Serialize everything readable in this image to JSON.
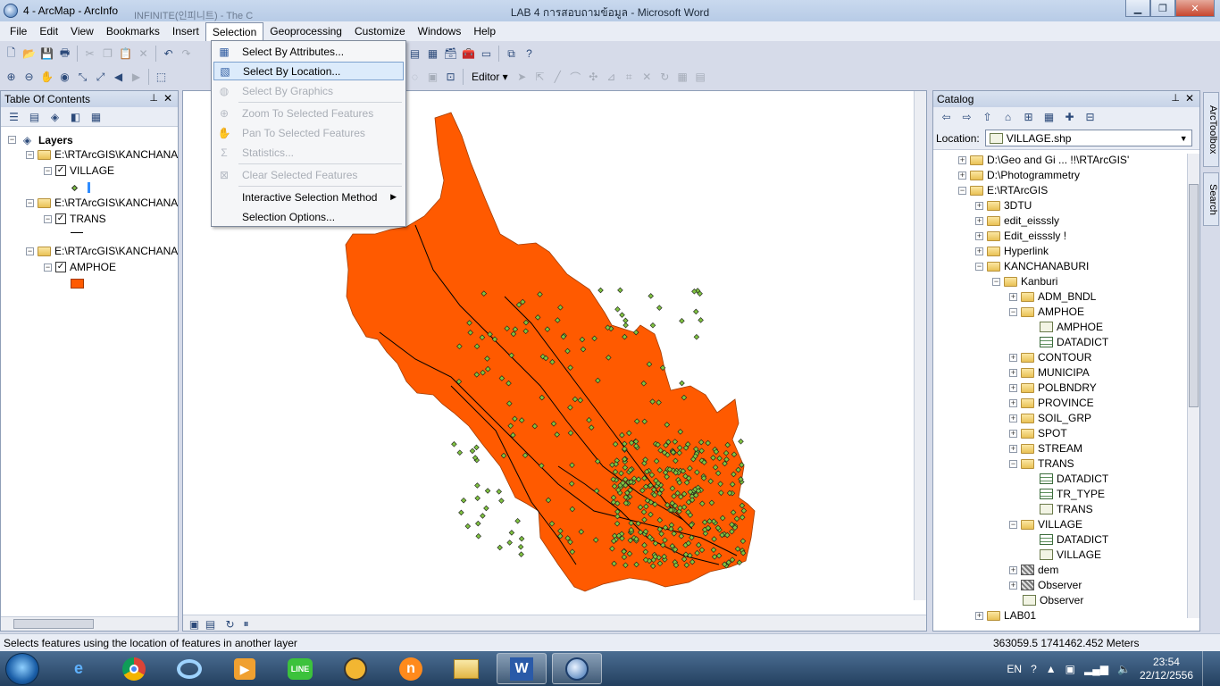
{
  "titlebar": {
    "title": "4 - ArcMap - ArcInfo",
    "background_title": "INFINITE(인피니트) - The C",
    "word_title": "LAB 4 การสอบถามข้อมูล - Microsoft Word",
    "minimize": "▁",
    "restore": "❐",
    "close": "✕"
  },
  "menubar": {
    "items": [
      "File",
      "Edit",
      "View",
      "Bookmarks",
      "Insert",
      "Selection",
      "Geoprocessing",
      "Customize",
      "Windows",
      "Help"
    ]
  },
  "toolbar": {
    "editor_label": "Editor ▾"
  },
  "selection_menu": {
    "items": [
      {
        "label": "Select By Attributes...",
        "icon": "table-select-icon",
        "enabled": true
      },
      {
        "label": "Select By Location...",
        "icon": "location-select-icon",
        "enabled": true,
        "highlighted": true
      },
      {
        "label": "Select By Graphics",
        "icon": "graphics-select-icon",
        "enabled": false
      },
      {
        "label": "Zoom To Selected Features",
        "icon": "zoom-selected-icon",
        "enabled": false
      },
      {
        "label": "Pan To Selected Features",
        "icon": "pan-selected-icon",
        "enabled": false
      },
      {
        "label": "Statistics...",
        "icon": "sigma-icon",
        "enabled": false
      },
      {
        "label": "Clear Selected Features",
        "icon": "clear-selection-icon",
        "enabled": false
      },
      {
        "label": "Interactive Selection Method",
        "icon": "",
        "enabled": true,
        "submenu": true
      },
      {
        "label": "Selection Options...",
        "icon": "",
        "enabled": true
      }
    ]
  },
  "toc": {
    "title": "Table Of Contents",
    "root": "Layers",
    "groups": [
      {
        "path": "E:\\RTArcGIS\\KANCHANA",
        "layer": "VILLAGE",
        "symbol": "point"
      },
      {
        "path": "E:\\RTArcGIS\\KANCHANA",
        "layer": "TRANS",
        "symbol": "line"
      },
      {
        "path": "E:\\RTArcGIS\\KANCHANA",
        "layer": "AMPHOE",
        "symbol": "polygon"
      }
    ]
  },
  "catalog": {
    "title": "Catalog",
    "location_label": "Location:",
    "location_value": "VILLAGE.shp",
    "tree": [
      {
        "label": "D:\\Geo and Gi ... !!\\RTArcGIS'",
        "indent": 0,
        "exp": "+",
        "type": "folder"
      },
      {
        "label": "D:\\Photogrammetry",
        "indent": 0,
        "exp": "+",
        "type": "folder"
      },
      {
        "label": "E:\\RTArcGIS",
        "indent": 0,
        "exp": "-",
        "type": "folder"
      },
      {
        "label": "3DTU",
        "indent": 1,
        "exp": "+",
        "type": "folder"
      },
      {
        "label": "edit_eisssly",
        "indent": 1,
        "exp": "+",
        "type": "folder"
      },
      {
        "label": "Edit_eisssly !",
        "indent": 1,
        "exp": "+",
        "type": "folder"
      },
      {
        "label": "Hyperlink",
        "indent": 1,
        "exp": "+",
        "type": "folder"
      },
      {
        "label": "KANCHANABURI",
        "indent": 1,
        "exp": "-",
        "type": "folder"
      },
      {
        "label": "Kanburi",
        "indent": 2,
        "exp": "-",
        "type": "folder"
      },
      {
        "label": "ADM_BNDL",
        "indent": 3,
        "exp": "+",
        "type": "folder"
      },
      {
        "label": "AMPHOE",
        "indent": 3,
        "exp": "-",
        "type": "folder"
      },
      {
        "label": "AMPHOE",
        "indent": 4,
        "exp": "",
        "type": "shp"
      },
      {
        "label": "DATADICT",
        "indent": 4,
        "exp": "",
        "type": "table"
      },
      {
        "label": "CONTOUR",
        "indent": 3,
        "exp": "+",
        "type": "folder"
      },
      {
        "label": "MUNICIPA",
        "indent": 3,
        "exp": "+",
        "type": "folder"
      },
      {
        "label": "POLBNDRY",
        "indent": 3,
        "exp": "+",
        "type": "folder"
      },
      {
        "label": "PROVINCE",
        "indent": 3,
        "exp": "+",
        "type": "folder"
      },
      {
        "label": "SOIL_GRP",
        "indent": 3,
        "exp": "+",
        "type": "folder"
      },
      {
        "label": "SPOT",
        "indent": 3,
        "exp": "+",
        "type": "folder"
      },
      {
        "label": "STREAM",
        "indent": 3,
        "exp": "+",
        "type": "folder"
      },
      {
        "label": "TRANS",
        "indent": 3,
        "exp": "-",
        "type": "folder"
      },
      {
        "label": "DATADICT",
        "indent": 4,
        "exp": "",
        "type": "table"
      },
      {
        "label": "TR_TYPE",
        "indent": 4,
        "exp": "",
        "type": "table"
      },
      {
        "label": "TRANS",
        "indent": 4,
        "exp": "",
        "type": "shp"
      },
      {
        "label": "VILLAGE",
        "indent": 3,
        "exp": "-",
        "type": "folder"
      },
      {
        "label": "DATADICT",
        "indent": 4,
        "exp": "",
        "type": "table"
      },
      {
        "label": "VILLAGE",
        "indent": 4,
        "exp": "",
        "type": "shp"
      },
      {
        "label": "dem",
        "indent": 3,
        "exp": "+",
        "type": "raster"
      },
      {
        "label": "Observer",
        "indent": 3,
        "exp": "+",
        "type": "raster"
      },
      {
        "label": "Observer",
        "indent": 3,
        "exp": "",
        "type": "shp"
      },
      {
        "label": "LAB01",
        "indent": 1,
        "exp": "+",
        "type": "folder"
      }
    ]
  },
  "sidetabs": [
    "ArcToolbox",
    "Search"
  ],
  "statusbar": {
    "message": "Selects features using the location of features in another layer",
    "coordinates": "363059.5  1741462.452 Meters"
  },
  "taskbar": {
    "lang": "EN",
    "time": "23:54",
    "date": "22/12/2556"
  },
  "colors": {
    "amphoe_fill": "#ff5a00",
    "village_point": "#7fc241",
    "trans_line": "#000000"
  }
}
